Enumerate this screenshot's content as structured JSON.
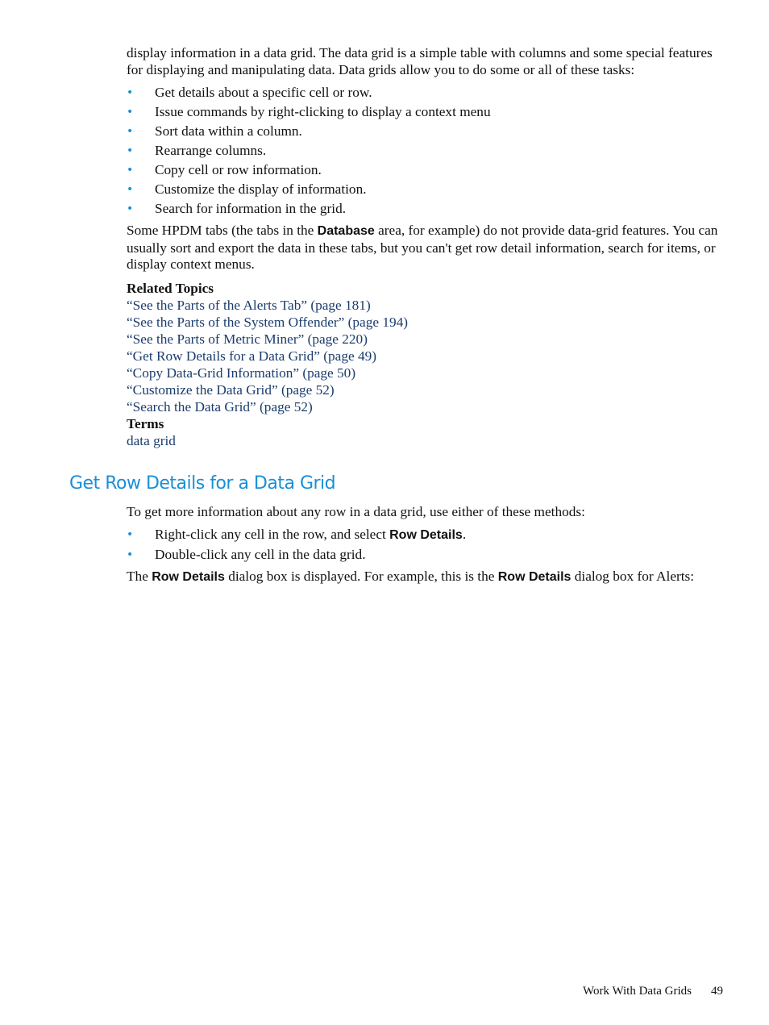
{
  "intro": "display information in a data grid. The data grid is a simple table with columns and some special features for displaying and manipulating data. Data grids allow you to do some or all of these tasks:",
  "tasks": [
    "Get details about a specific cell or row.",
    "Issue commands by right-clicking to display a context menu",
    "Sort data within a column.",
    "Rearrange columns.",
    "Copy cell or row information.",
    "Customize the display of information.",
    "Search for information in the grid."
  ],
  "note": {
    "before": "Some HPDM tabs (the tabs in the ",
    "bold": "Database",
    "after": " area, for example) do not provide data-grid features. You can usually sort and export the data in these tabs, but you can't get row detail information, search for items, or display context menus."
  },
  "related_topics": {
    "label": "Related Topics",
    "links": [
      "“See the Parts of the Alerts Tab” (page 181)",
      "“See the Parts of the System Offender” (page 194)",
      "“See the Parts of Metric Miner” (page 220)",
      "“Get Row Details for a Data Grid” (page 49)",
      "“Copy Data-Grid Information” (page 50)",
      "“Customize the Data Grid” (page 52)",
      "“Search the Data Grid” (page 52)"
    ]
  },
  "terms": {
    "label": "Terms",
    "links": [
      "data grid"
    ]
  },
  "section": {
    "heading": "Get Row Details for a Data Grid",
    "lead": "To get more information about any row in a data grid, use either of these methods:",
    "methods": [
      {
        "before": "Right-click any cell in the row, and select ",
        "bold": "Row Details",
        "after": "."
      },
      {
        "before": "Double-click any cell in the data grid.",
        "bold": "",
        "after": ""
      }
    ],
    "result": {
      "p1": "The ",
      "b1": "Row Details",
      "p2": " dialog box is displayed. For example, this is the ",
      "b2": "Row Details",
      "p3": " dialog box for Alerts:"
    }
  },
  "footer": {
    "chapter": "Work With Data Grids",
    "page_number": "49"
  },
  "bullet_glyph": "•"
}
